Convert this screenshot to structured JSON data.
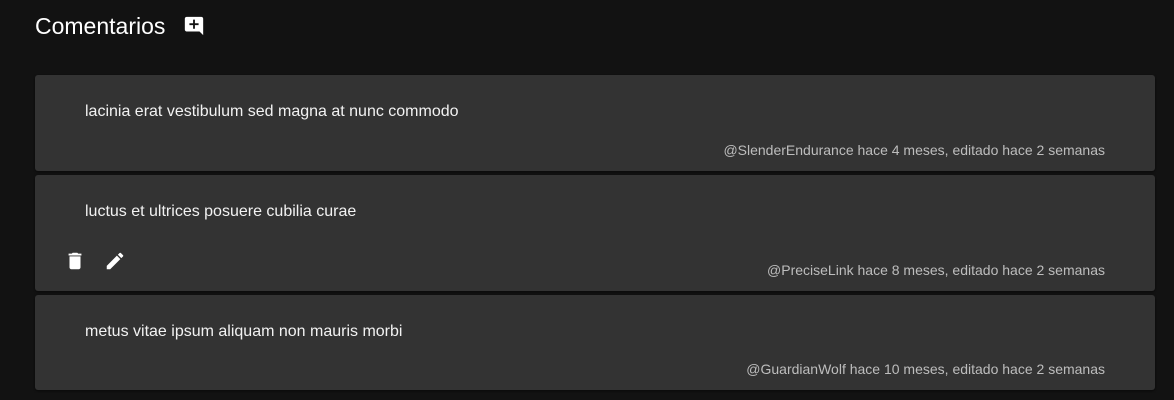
{
  "header": {
    "title": "Comentarios",
    "add_icon": "add-comment-icon"
  },
  "comments": [
    {
      "text": "lacinia erat vestibulum sed magna at nunc commodo",
      "meta": "@SlenderEndurance hace 4 meses, editado hace 2 semanas"
    },
    {
      "text": "luctus et ultrices posuere cubilia curae",
      "meta": "@PreciseLink hace 8 meses, editado hace 2 semanas",
      "actions": [
        "delete-icon",
        "edit-icon"
      ]
    },
    {
      "text": "metus vitae ipsum aliquam non mauris morbi",
      "meta": "@GuardianWolf hace 10 meses, editado hace 2 semanas"
    }
  ],
  "colors": {
    "background": "#121212",
    "card": "#333333",
    "text": "#ffffff",
    "meta": "#bdbdbd"
  }
}
